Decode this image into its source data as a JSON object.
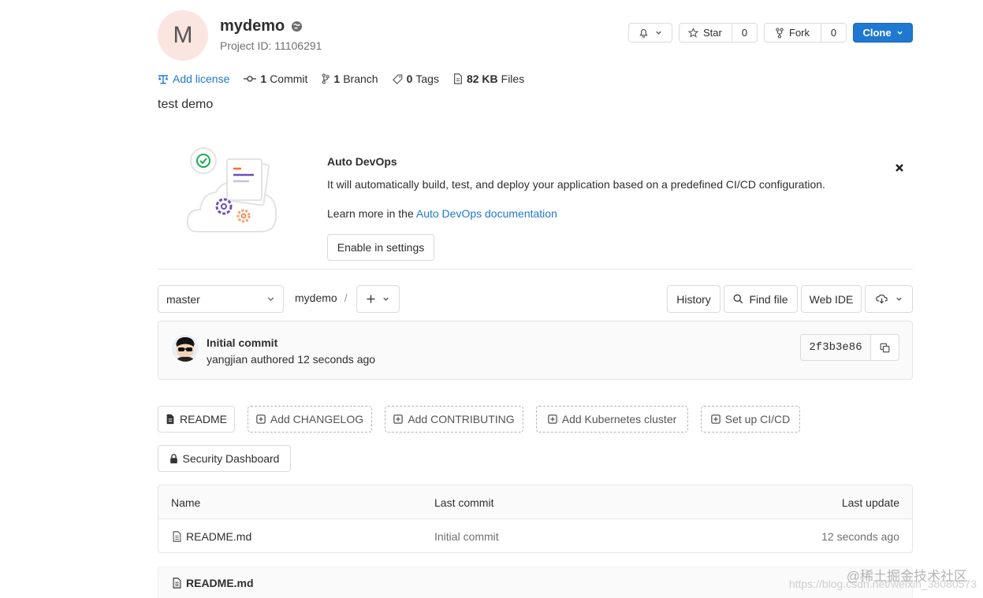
{
  "project": {
    "avatar_letter": "M",
    "name": "mydemo",
    "id_label": "Project ID: 11106291",
    "description": "test demo"
  },
  "actions": {
    "star_label": "Star",
    "star_count": "0",
    "fork_label": "Fork",
    "fork_count": "0",
    "clone_label": "Clone"
  },
  "stats": {
    "add_license": "Add license",
    "commit_count": "1",
    "commit_label": "Commit",
    "branch_count": "1",
    "branch_label": "Branch",
    "tag_count": "0",
    "tag_label": "Tags",
    "files_size": "82 KB",
    "files_label": "Files"
  },
  "devops": {
    "title": "Auto DevOps",
    "text": "It will automatically build, test, and deploy your application based on a predefined CI/CD configuration.",
    "learn_prefix": "Learn more in the ",
    "learn_link": "Auto DevOps documentation",
    "enable_button": "Enable in settings"
  },
  "repo": {
    "branch": "master",
    "path_root": "mydemo",
    "path_sep": "/",
    "history": "History",
    "find_file": "Find file",
    "web_ide": "Web IDE"
  },
  "commit": {
    "title": "Initial commit",
    "author": "yangjian",
    "authored_text": " authored 12 seconds ago",
    "sha": "2f3b3e86"
  },
  "quick_links": [
    "README",
    "Add CHANGELOG",
    "Add CONTRIBUTING",
    "Add Kubernetes cluster",
    "Set up CI/CD"
  ],
  "security_dashboard": "Security Dashboard",
  "file_table": {
    "headers": [
      "Name",
      "Last commit",
      "Last update"
    ],
    "rows": [
      {
        "name": "README.md",
        "last_commit": "Initial commit",
        "last_update": "12 seconds ago"
      }
    ]
  },
  "readme_header": "README.md",
  "watermark": {
    "line1": "@稀土掘金技术社区",
    "line2": "https://blog.csdn.net/weixin_38080573"
  },
  "colors": {
    "link": "#1f78d1",
    "clone_bg": "#1f78d1",
    "avatar_bg": "#fbe5e1"
  }
}
